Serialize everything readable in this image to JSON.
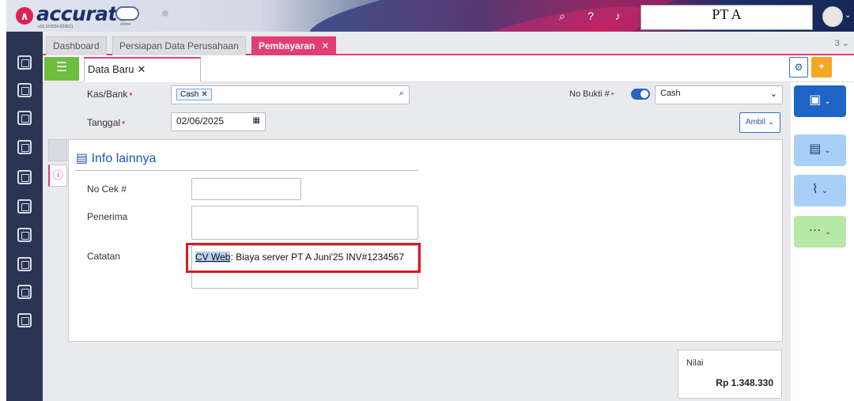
{
  "app": {
    "logo_text": "accurate",
    "version": "v10.1#3334-823621",
    "logo_sub": "online",
    "company": "PT A"
  },
  "tabs": [
    {
      "label": "Dashboard"
    },
    {
      "label": "Persiapan Data Perusahaan"
    },
    {
      "label": "Pembayaran",
      "active": true
    }
  ],
  "tabs_count": "3 ⌄",
  "form_tab": {
    "label": "Data Baru"
  },
  "fields": {
    "kas_bank_label": "Kas/Bank",
    "kas_bank_value": "Cash",
    "tanggal_label": "Tanggal",
    "tanggal_value": "02/06/2025",
    "no_bukti_label": "No Bukti #",
    "no_bukti_value": "Cash",
    "ambil_label": "Ambil"
  },
  "panel": {
    "title": "Info lainnya",
    "no_cek_label": "No Cek #",
    "no_cek_value": "",
    "penerima_label": "Penerima",
    "penerima_value": "",
    "catatan_label": "Catatan",
    "catatan_highlight": "CV Web",
    "catatan_rest": ": Biaya server PT A Juni'25 INV#1234567"
  },
  "nilai": {
    "label": "Nilai",
    "value": "Rp 1.348.330"
  },
  "colors": {
    "accent": "#e23e73",
    "primary": "#1e63c6",
    "nav_bg": "#2b3553"
  }
}
